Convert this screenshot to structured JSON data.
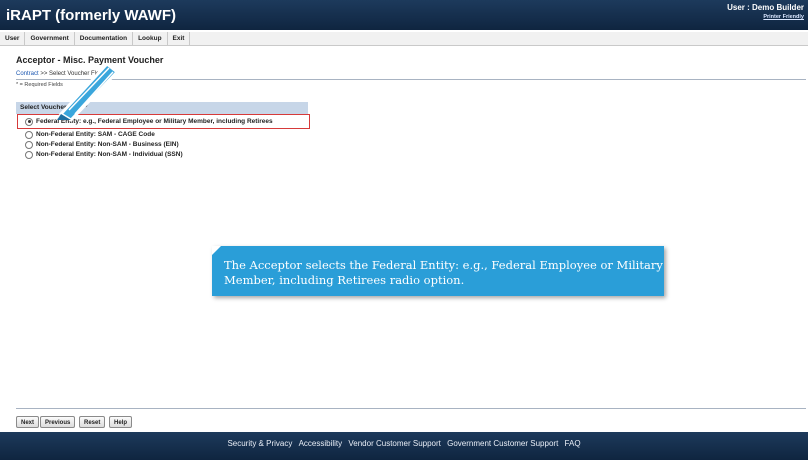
{
  "header": {
    "app_title": "iRAPT (formerly WAWF)",
    "user_label": "User : Demo Builder",
    "printer_friendly": "Printer Friendly"
  },
  "menu": [
    "User",
    "Government",
    "Documentation",
    "Lookup",
    "Exit"
  ],
  "page": {
    "title": "Acceptor - Misc. Payment Voucher",
    "breadcrumb_link": "Contract",
    "breadcrumb_rest": ">> Select Voucher Flow",
    "required_note": "* = Required Fields"
  },
  "section": {
    "heading": "Select Voucher Flow *",
    "options": [
      {
        "label": "Federal Entity: e.g., Federal Employee or Military Member, including Retirees",
        "selected": true
      },
      {
        "label": "Non-Federal Entity: SAM - CAGE Code",
        "selected": false
      },
      {
        "label": "Non-Federal Entity: Non-SAM - Business (EIN)",
        "selected": false
      },
      {
        "label": "Non-Federal Entity: Non-SAM - Individual (SSN)",
        "selected": false
      }
    ]
  },
  "buttons": {
    "next": "Next",
    "previous": "Previous",
    "reset": "Reset",
    "help": "Help"
  },
  "footer": [
    "Security & Privacy",
    "Accessibility",
    "Vendor Customer Support",
    "Government Customer Support",
    "FAQ"
  ],
  "callout": {
    "text": "The Acceptor selects the Federal Entity: e.g., Federal Employee or Military Member, including Retirees radio option."
  },
  "colors": {
    "header_bg": "#1a3554",
    "section_bg": "#c7d6e8",
    "highlight": "#d63a3a",
    "callout_bg": "#2a9ed8",
    "link": "#1a56b0"
  },
  "icons": {
    "pointer": "pencil-pointer-icon"
  }
}
